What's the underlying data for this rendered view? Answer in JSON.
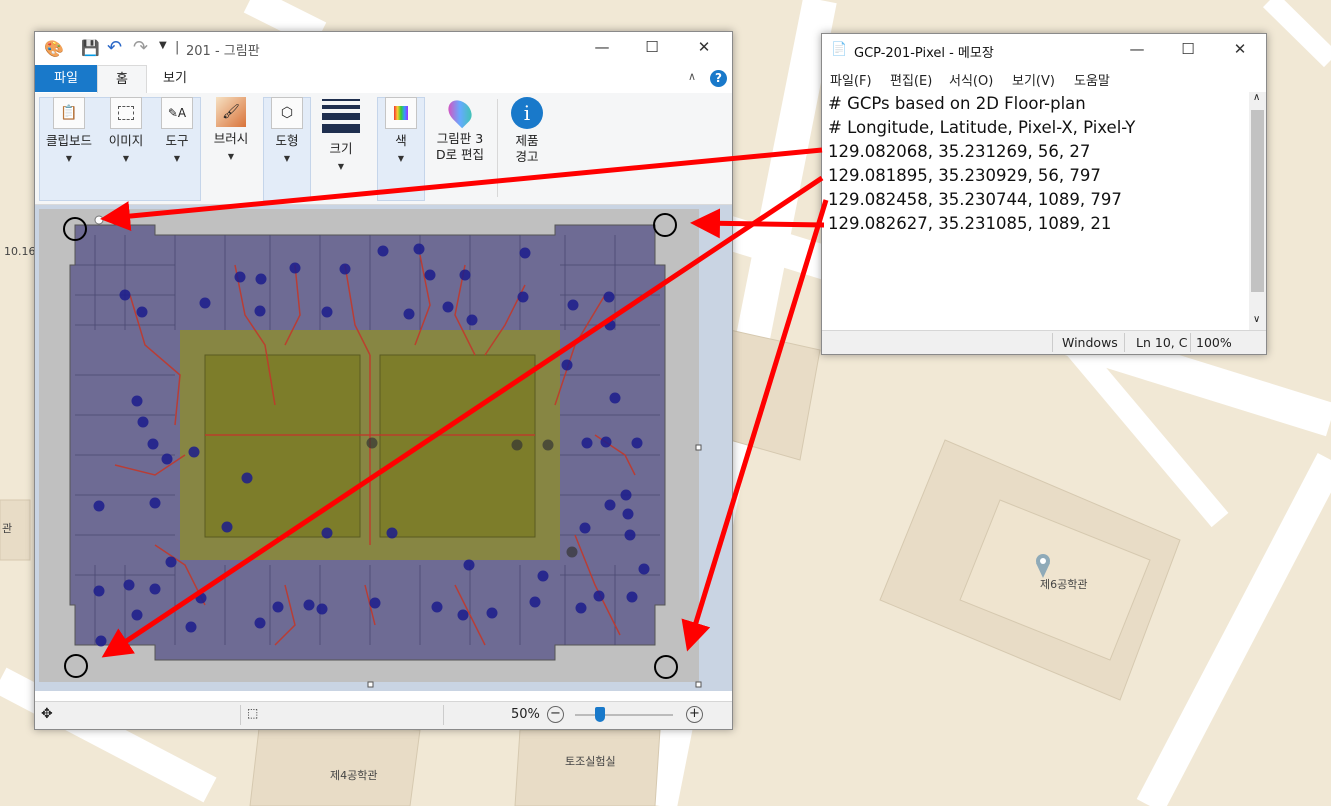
{
  "map": {
    "labels": [
      "10.16",
      "관",
      "제6공학관",
      "제4공학관",
      "토조실험실"
    ]
  },
  "paint": {
    "title": "201 - 그림판",
    "title_sep": "|",
    "tabs": [
      "파일",
      "홈",
      "보기"
    ],
    "help_icon": "?",
    "ribbon": {
      "clipboard": "클립보드",
      "image": "이미지",
      "tools": "도구",
      "brushes": "브러시",
      "shapes": "도형",
      "size": "크기",
      "color": "색",
      "paint3d": "그림판 3\nD로 편집",
      "product_alert": "제품\n경고"
    },
    "status": {
      "zoom": "50%"
    }
  },
  "notepad": {
    "title": "GCP-201-Pixel - 메모장",
    "menu": [
      "파일(F)",
      "편집(E)",
      "서식(O)",
      "보기(V)",
      "도움말"
    ],
    "lines": [
      "# GCPs based on 2D Floor-plan",
      "# Longitude, Latitude, Pixel-X, Pixel-Y",
      "129.082068, 35.231269, 56, 27",
      "129.081895, 35.230929, 56, 797",
      "129.082458, 35.230744, 1089, 797",
      "129.082627, 35.231085, 1089, 21"
    ],
    "status": {
      "eol": "Windows",
      "pos": "Ln 10, C",
      "zoom": "100%"
    }
  },
  "colors": {
    "accent_tab": "#1979ca",
    "arrow": "#ff0000",
    "map_bg": "#f1e8d5",
    "map_road": "#ffffff",
    "floorplan_fill": "#6e6b94",
    "courtyard": "#8a8a3a",
    "point": "#1c1c8c",
    "path": "#c0392b"
  }
}
